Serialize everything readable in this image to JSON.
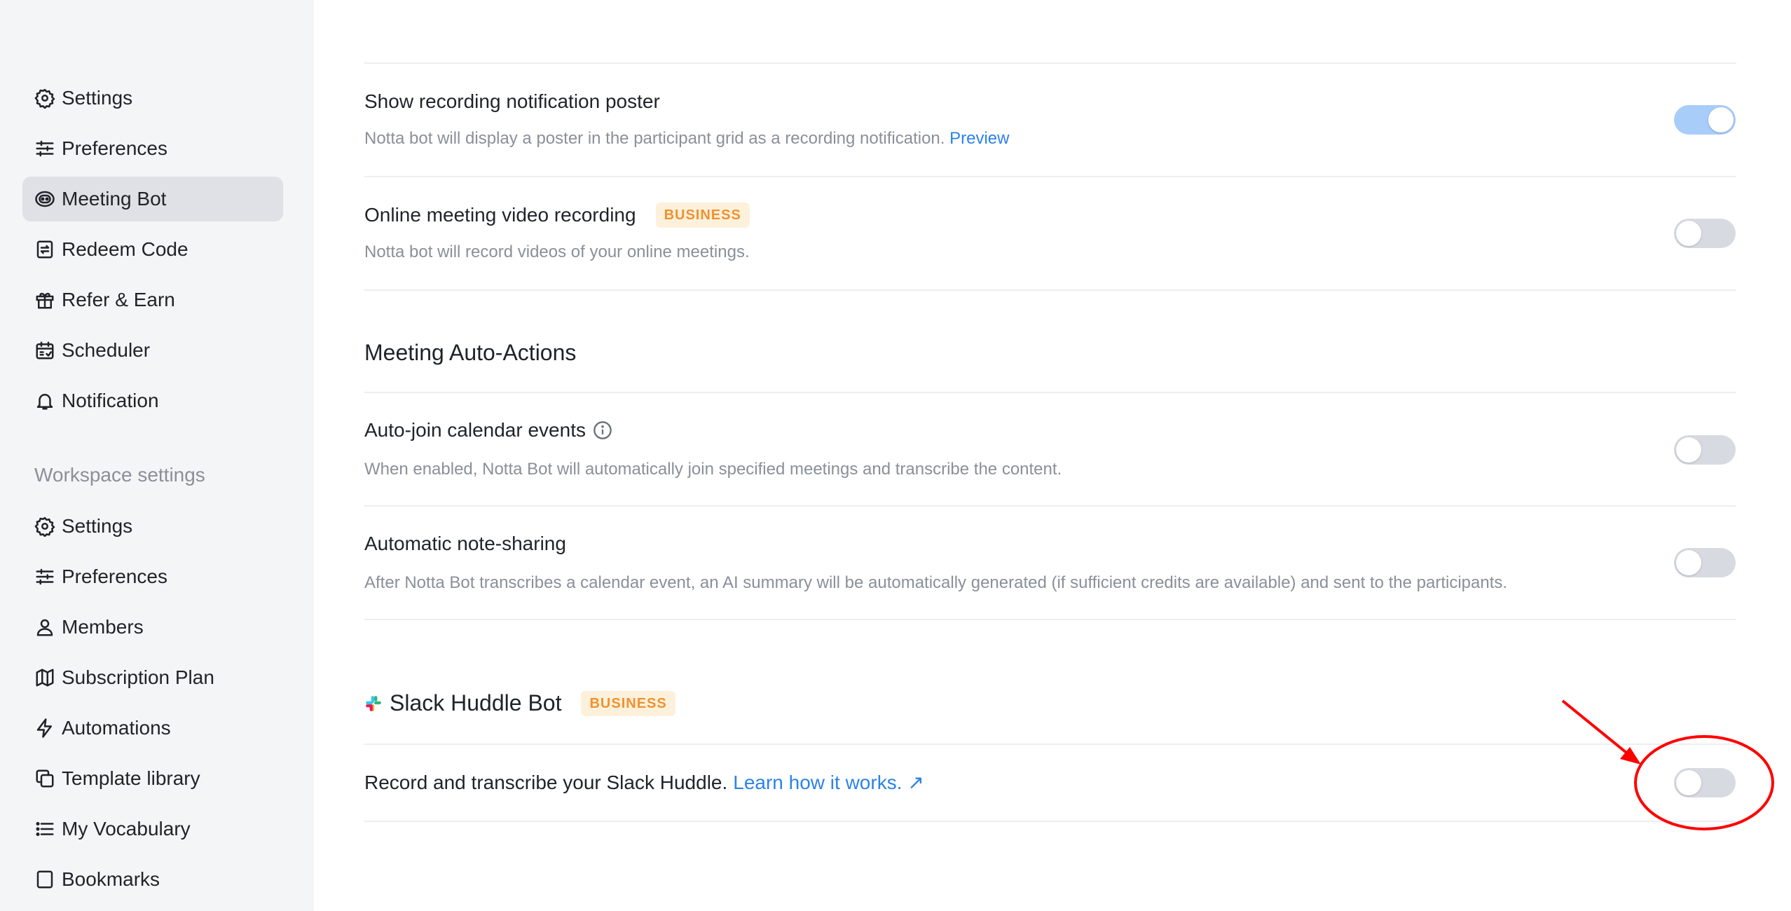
{
  "sidebar": {
    "personal_items": [
      {
        "label": "Settings",
        "icon": "gear-icon"
      },
      {
        "label": "Preferences",
        "icon": "sliders-icon"
      },
      {
        "label": "Meeting Bot",
        "icon": "bot-icon",
        "active": true
      },
      {
        "label": "Redeem Code",
        "icon": "redeem-icon"
      },
      {
        "label": "Refer & Earn",
        "icon": "gift-icon"
      },
      {
        "label": "Scheduler",
        "icon": "calendar-icon"
      },
      {
        "label": "Notification",
        "icon": "bell-icon"
      }
    ],
    "workspace_title": "Workspace settings",
    "workspace_items": [
      {
        "label": "Settings",
        "icon": "gear-icon"
      },
      {
        "label": "Preferences",
        "icon": "sliders-icon"
      },
      {
        "label": "Members",
        "icon": "user-icon"
      },
      {
        "label": "Subscription Plan",
        "icon": "map-icon"
      },
      {
        "label": "Automations",
        "icon": "bolt-icon"
      },
      {
        "label": "Template library",
        "icon": "copy-icon"
      },
      {
        "label": "My Vocabulary",
        "icon": "list-icon"
      },
      {
        "label": "Bookmarks",
        "icon": "bookmark-icon"
      }
    ]
  },
  "main": {
    "recording_poster": {
      "title": "Show recording notification poster",
      "desc": "Notta bot will display a poster in the participant grid as a recording notification.",
      "link": "Preview",
      "enabled": true
    },
    "video_recording": {
      "title": "Online meeting video recording",
      "badge": "BUSINESS",
      "desc": "Notta bot will record videos of your online meetings.",
      "enabled": false
    },
    "auto_actions": {
      "heading": "Meeting Auto-Actions",
      "auto_join": {
        "title": "Auto-join calendar events",
        "desc": "When enabled, Notta Bot will automatically join specified meetings and transcribe the content.",
        "enabled": false
      },
      "note_sharing": {
        "title": "Automatic note-sharing",
        "desc": "After Notta Bot transcribes a calendar event, an AI summary will be automatically generated (if sufficient credits are available) and sent to the participants.",
        "enabled": false
      }
    },
    "slack": {
      "heading": "Slack Huddle Bot",
      "badge": "BUSINESS",
      "text": "Record and transcribe your Slack Huddle.",
      "link": "Learn how it works. ↗",
      "enabled": false
    }
  },
  "colors": {
    "accent": "#2b83e8",
    "badge_text": "#f0912f",
    "badge_bg": "#fdf1dc",
    "annotation": "#ff0000",
    "toggle_on": "#a9cdf9",
    "toggle_off": "#d7dbe1"
  }
}
